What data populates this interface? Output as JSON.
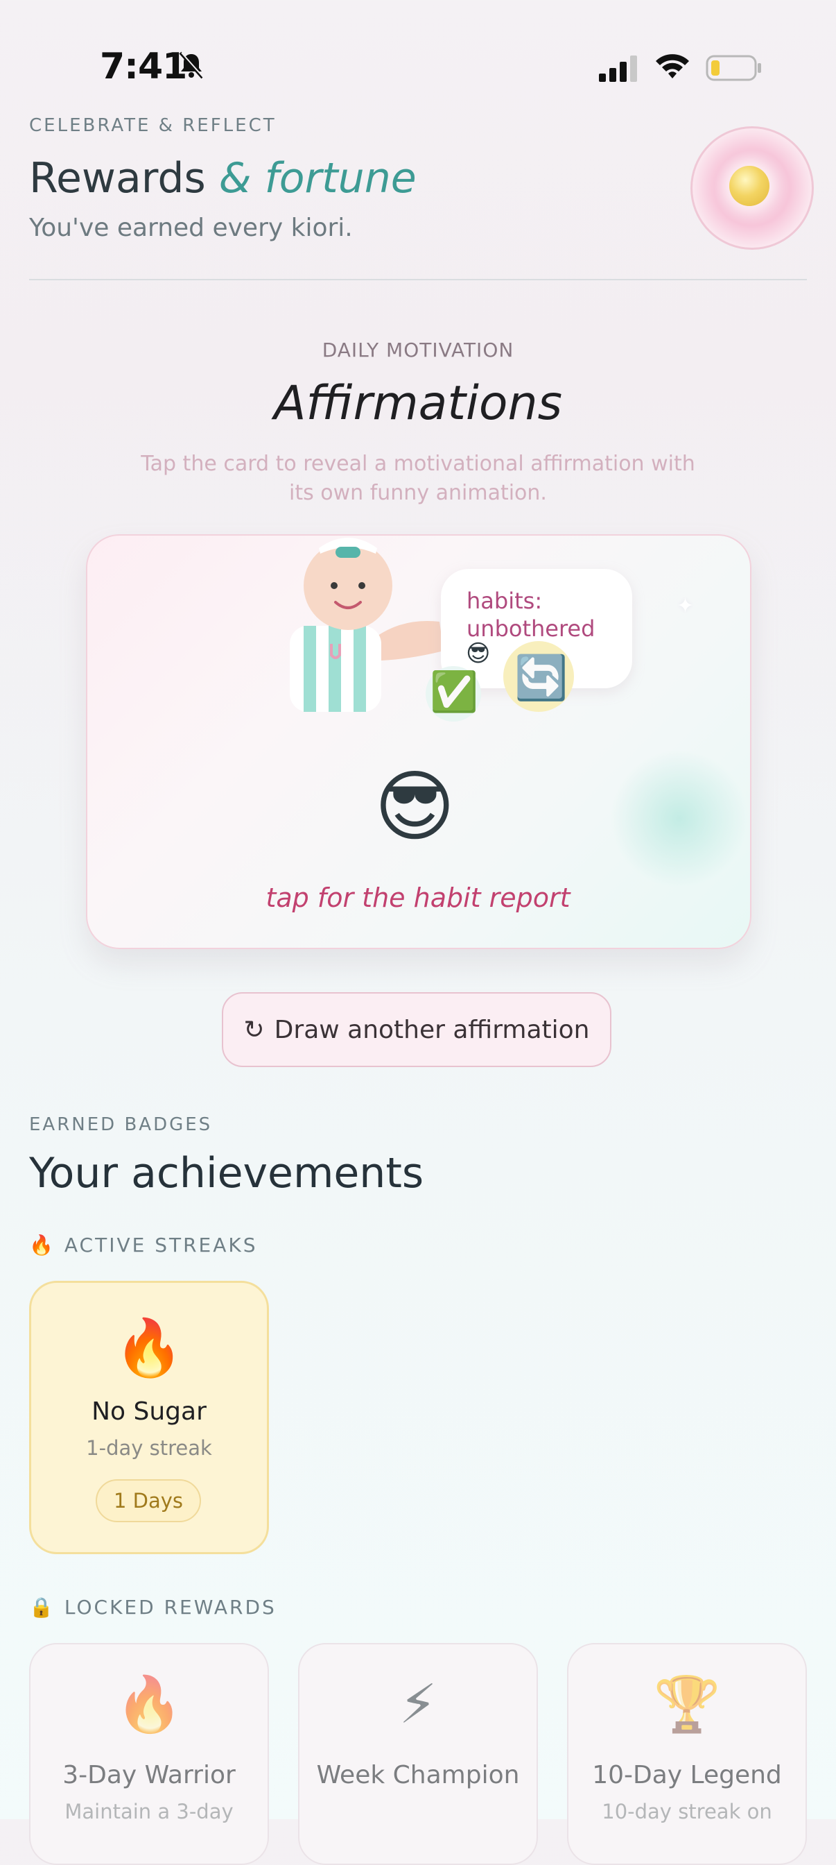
{
  "status": {
    "time": "7:41"
  },
  "header": {
    "eyebrow": "CELEBRATE & REFLECT",
    "title_main": "Rewards",
    "title_accent": "& fortune",
    "subtitle": "You've earned every kiori."
  },
  "affirmations": {
    "eyebrow": "DAILY MOTIVATION",
    "title": "Affirmations",
    "description_line1": "Tap the card to reveal a motivational affirmation with",
    "description_line2": "its own funny animation.",
    "bubble_text": "habits: unbothered",
    "bubble_emoji": "😎",
    "check_emoji": "✅",
    "swap_emoji": "🔄",
    "big_emoji": "😎",
    "tap_label": "tap for the habit report",
    "draw_button": "Draw another affirmation",
    "draw_icon": "↻"
  },
  "achievements": {
    "eyebrow": "EARNED BADGES",
    "title": "Your achievements",
    "active_label": "ACTIVE STREAKS",
    "active_icon": "🔥",
    "streaks": [
      {
        "emoji": "🔥",
        "name": "No Sugar",
        "sub": "1-day streak",
        "badge": "1 Days"
      }
    ],
    "locked_label": "LOCKED REWARDS",
    "locked_icon": "🔒",
    "locked": [
      {
        "emoji": "🔥",
        "name": "3-Day Warrior",
        "sub": "Maintain a 3-day"
      },
      {
        "emoji": "⚡",
        "name": "Week Champion",
        "sub": ""
      },
      {
        "emoji": "🏆",
        "name": "10-Day Legend",
        "sub": "10-day streak on"
      }
    ]
  },
  "colors": {
    "accent": "#3d9b94",
    "pink_text": "#c2416f",
    "streak_bg": "#fdf4d4"
  }
}
